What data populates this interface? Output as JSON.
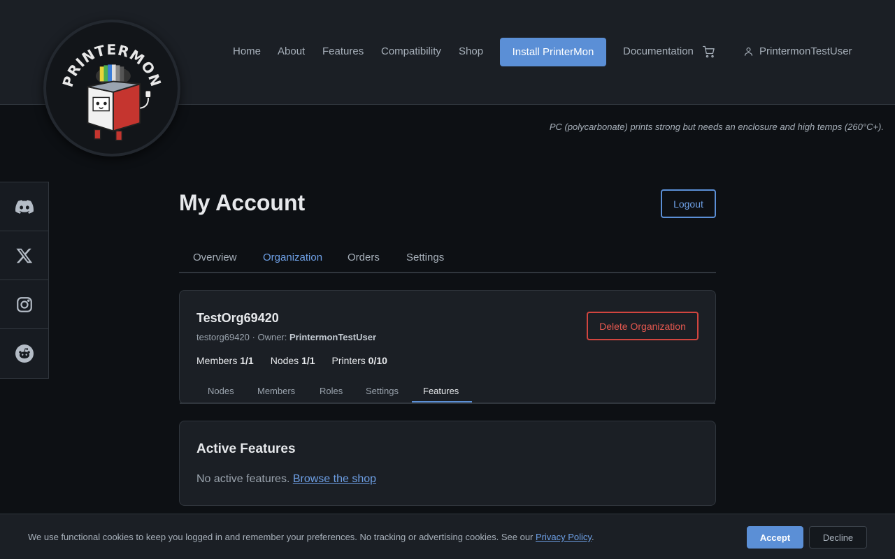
{
  "brand": {
    "logo_text": "PRINTERMON",
    "logo_icon": "printermon-mascot-logo"
  },
  "nav": {
    "items": [
      {
        "label": "Home"
      },
      {
        "label": "About"
      },
      {
        "label": "Features"
      },
      {
        "label": "Compatibility"
      },
      {
        "label": "Shop"
      }
    ],
    "install_label": "Install PrinterMon",
    "documentation_label": "Documentation",
    "cart_icon": "cart-icon",
    "user_icon": "user-icon",
    "username": "PrintermonTestUser"
  },
  "tip": "PC (polycarbonate) prints strong but needs an enclosure and high temps (260°C+).",
  "social": [
    {
      "name": "discord-icon"
    },
    {
      "name": "x-icon"
    },
    {
      "name": "instagram-icon"
    },
    {
      "name": "reddit-icon"
    }
  ],
  "account": {
    "title": "My Account",
    "logout_label": "Logout",
    "tabs": [
      {
        "label": "Overview",
        "active": false
      },
      {
        "label": "Organization",
        "active": true
      },
      {
        "label": "Orders",
        "active": false
      },
      {
        "label": "Settings",
        "active": false
      }
    ]
  },
  "org": {
    "name": "TestOrg69420",
    "slug": "testorg69420",
    "owner_prefix": " · Owner: ",
    "owner": "PrintermonTestUser",
    "delete_label": "Delete Organization",
    "stats": [
      {
        "label": "Members ",
        "value": "1/1"
      },
      {
        "label": "Nodes ",
        "value": "1/1"
      },
      {
        "label": "Printers ",
        "value": "0/10"
      }
    ],
    "subtabs": [
      {
        "label": "Nodes",
        "active": false
      },
      {
        "label": "Members",
        "active": false
      },
      {
        "label": "Roles",
        "active": false
      },
      {
        "label": "Settings",
        "active": false
      },
      {
        "label": "Features",
        "active": true
      }
    ]
  },
  "features": {
    "title": "Active Features",
    "empty_text": "No active features. ",
    "shop_link": "Browse the shop"
  },
  "cookie": {
    "text": "We use functional cookies to keep you logged in and remember your preferences. No tracking or advertising cookies. See our ",
    "policy_link": "Privacy Policy",
    "suffix": ".",
    "accept_label": "Accept",
    "decline_label": "Decline"
  },
  "colors": {
    "accent": "#5b8fd6",
    "danger": "#d2453f",
    "background": "#0d1014",
    "surface": "#1b1f25"
  }
}
